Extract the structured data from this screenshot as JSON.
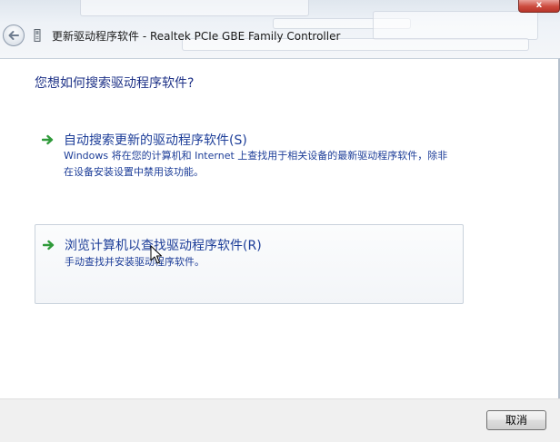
{
  "window": {
    "title": "更新驱动程序软件 - Realtek PCIe GBE Family Controller",
    "close_label": "x"
  },
  "main": {
    "heading": "您想如何搜索驱动程序软件?",
    "options": [
      {
        "title": "自动搜索更新的驱动程序软件(S)",
        "description": "Windows 将在您的计算机和 Internet 上查找用于相关设备的最新驱动程序软件，除非在设备安装设置中禁用该功能。"
      },
      {
        "title": "浏览计算机以查找驱动程序软件(R)",
        "description": "手动查找并安装驱动程序软件。"
      }
    ]
  },
  "footer": {
    "cancel_label": "取消"
  },
  "colors": {
    "link_blue": "#1c3d98",
    "heading_blue": "#1e3287",
    "arrow_green": "#2f9a3a"
  },
  "icons": {
    "back": "back-arrow-icon",
    "device": "network-device-icon",
    "option_arrow": "green-arrow-icon",
    "cursor": "mouse-pointer-icon"
  }
}
